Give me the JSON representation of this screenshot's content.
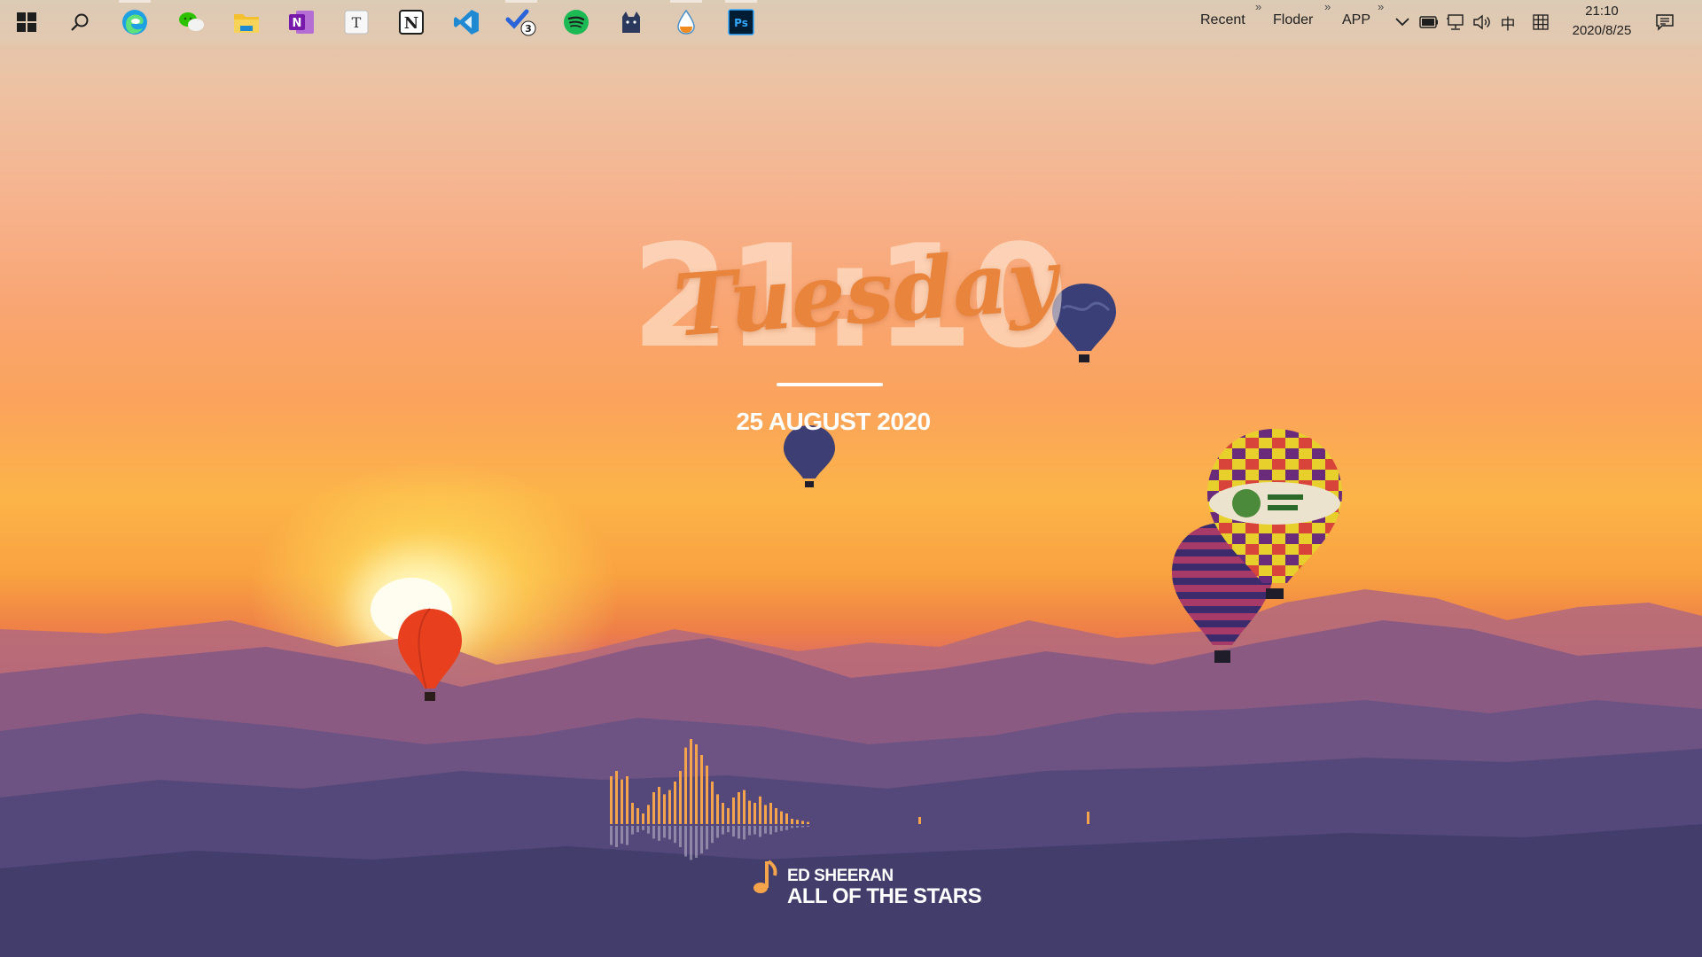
{
  "taskbar": {
    "pinned_icons": [
      {
        "name": "start-icon"
      },
      {
        "name": "search-icon"
      },
      {
        "name": "edge-icon",
        "color": "#1fa0e3"
      },
      {
        "name": "wechat-icon",
        "color": "#2dc100"
      },
      {
        "name": "file-explorer-icon",
        "color": "#f4c02e"
      },
      {
        "name": "onenote-icon",
        "color": "#7719aa",
        "glyph": "N"
      },
      {
        "name": "typora-icon",
        "glyph": "T"
      },
      {
        "name": "notion-icon",
        "glyph": "N"
      },
      {
        "name": "vscode-icon",
        "color": "#1f8ad2"
      },
      {
        "name": "todo-icon",
        "color": "#2a64d8",
        "badge": "3"
      },
      {
        "name": "spotify-icon",
        "color": "#1db954"
      },
      {
        "name": "cat-app-icon",
        "color": "#2b3a5c"
      },
      {
        "name": "drop-app-icon",
        "color": "#f08a1c"
      },
      {
        "name": "photoshop-icon",
        "color": "#31a8ff",
        "glyph": "Ps"
      }
    ],
    "menus": [
      {
        "label": "Recent"
      },
      {
        "label": "Floder"
      },
      {
        "label": "APP"
      }
    ],
    "tray": {
      "ime_label": "中",
      "clock_time": "21:10",
      "clock_date": "2020/8/25"
    }
  },
  "widget": {
    "time": "21:10",
    "weekday": "Tuesday",
    "date": "25 AUGUST 2020"
  },
  "music": {
    "artist": "ED SHEERAN",
    "title": "ALL OF THE STARS",
    "accent_color": "#f5a44c",
    "spectrum": [
      0.45,
      0.5,
      0.42,
      0.45,
      0.2,
      0.15,
      0.1,
      0.18,
      0.3,
      0.35,
      0.28,
      0.32,
      0.4,
      0.5,
      0.72,
      0.8,
      0.75,
      0.65,
      0.55,
      0.4,
      0.28,
      0.2,
      0.15,
      0.25,
      0.3,
      0.32,
      0.22,
      0.2,
      0.26,
      0.18,
      0.2,
      0.15,
      0.12,
      0.1,
      0.05,
      0.04,
      0.03,
      0.02
    ]
  },
  "colors": {
    "balloon_red": "#e8401e",
    "balloon_navy": "#3a3f78",
    "balloon_yellow": "#e8d02c"
  }
}
